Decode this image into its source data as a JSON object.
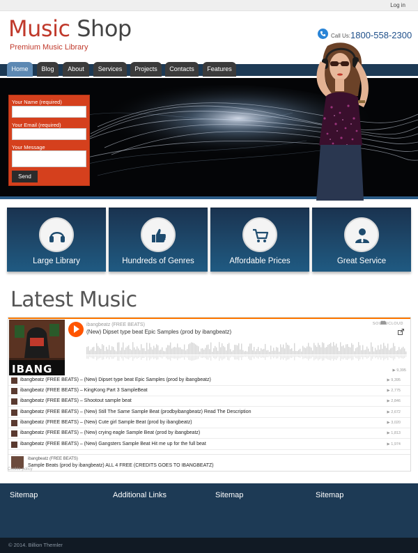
{
  "topbar": {
    "login": "Log in"
  },
  "header": {
    "logo_word1": "Music",
    "logo_word2": "Shop",
    "tagline": "Premium Music Library",
    "call_label": "Call Us:",
    "phone": "1800-558-2300"
  },
  "nav": [
    {
      "label": "Home",
      "active": true
    },
    {
      "label": "Blog"
    },
    {
      "label": "About"
    },
    {
      "label": "Services"
    },
    {
      "label": "Projects"
    },
    {
      "label": "Contacts"
    },
    {
      "label": "Features"
    }
  ],
  "contact_form": {
    "name_label": "Your Name (required)",
    "email_label": "Your Email (required)",
    "message_label": "Your Message",
    "send_label": "Send",
    "color": "#d5401d"
  },
  "services": [
    {
      "label": "Large Library",
      "icon": "headphones-icon"
    },
    {
      "label": "Hundreds of Genres",
      "icon": "thumbs-up-icon"
    },
    {
      "label": "Affordable Prices",
      "icon": "shopping-cart-icon"
    },
    {
      "label": "Great Service",
      "icon": "user-icon"
    }
  ],
  "latest": {
    "title": "Latest Music",
    "player": {
      "artist": "ibangbeatz (FREE BEATS)",
      "track": "(New) Dipset type beat Epic Samples (prod by ibangbeatz)",
      "brand": "SOUNDCLOUD",
      "plays": "▶ 9,395",
      "art_text": "IBANG"
    },
    "tracks": [
      {
        "text": "ibangbeatz (FREE BEATS) – (New) Dipset type beat Epic Samples (prod by ibangbeatz)",
        "plays": "▶ 9,395"
      },
      {
        "text": "ibangbeatz (FREE BEATS) – KingKong Part 3 SampleBeat",
        "plays": "▶ 2,775"
      },
      {
        "text": "ibangbeatz (FREE BEATS) – Shootout sample beat",
        "plays": "▶ 2,846"
      },
      {
        "text": "ibangbeatz (FREE BEATS) – (New) Still The Same Sample Beat (prodbyibangbeatz) Read The Description",
        "plays": "▶ 2,672"
      },
      {
        "text": "ibangbeatz (FREE BEATS) – (New) Cute girl Sample Beat (prod by ibangbeatz)",
        "plays": "▶ 3,020"
      },
      {
        "text": "ibangbeatz (FREE BEATS) – (New) crying eagle Sample Beat (prod by ibangbeatz)",
        "plays": "▶ 1,813"
      },
      {
        "text": "ibangbeatz (FREE BEATS) – (New) Gangsters Sample Beat Hit me up for the full beat",
        "plays": "▶ 1,974"
      }
    ],
    "now_playing": {
      "artist": "ibangbeatz (FREE BEATS)",
      "track": "Sample Beats (prod by ibangbeatz) ALL 4 FREE (CREDITS GOES TO IBANGBEATZ)"
    },
    "cookie": "Cookie policy"
  },
  "footer": {
    "columns": [
      "Sitemap",
      "Additional Links",
      "Sitemap",
      "Sitemap"
    ],
    "copyright": "© 2014. Billion Themler"
  },
  "colors": {
    "brand_red": "#c0392b",
    "navy": "#1d3a55",
    "soundcloud_orange": "#ff5500"
  }
}
